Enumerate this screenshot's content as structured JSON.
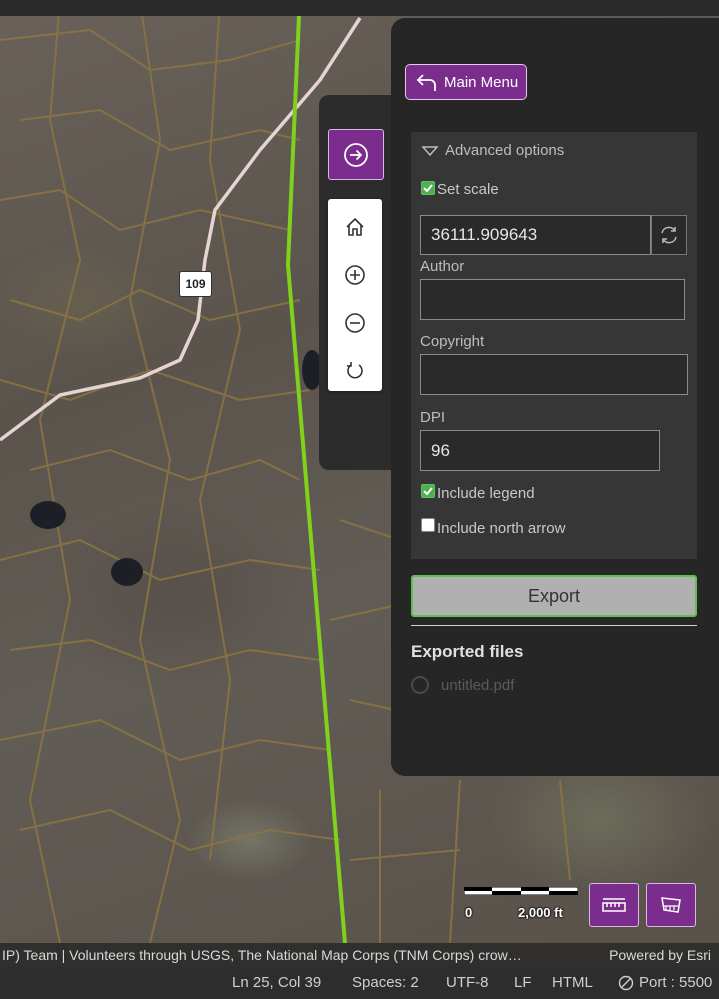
{
  "map": {
    "road_shield": "109",
    "scale_left": "0",
    "scale_right": "2,000 ft",
    "attribution": "IP) Team | Volunteers through USGS, The National Map Corps (TNM Corps) crow…",
    "powered_by": "Powered by Esri"
  },
  "widget": {
    "toggle_icon": "arrow-right-circle-icon",
    "zoom_buttons": [
      "home-icon",
      "zoom-in-icon",
      "zoom-out-icon",
      "rotate-icon"
    ]
  },
  "print_panel": {
    "main_menu_label": "Main Menu",
    "advanced_label": "Advanced options",
    "set_scale_label": "Set scale",
    "set_scale_checked": true,
    "scale_value": "36111.909643",
    "author_label": "Author",
    "author_value": "",
    "copyright_label": "Copyright",
    "copyright_value": "",
    "dpi_label": "DPI",
    "dpi_value": "96",
    "include_legend_label": "Include legend",
    "include_legend_checked": true,
    "north_arrow_label": "Include north arrow",
    "north_arrow_checked": false,
    "export_label": "Export",
    "exported_title": "Exported files",
    "exported_file": "untitled.pdf"
  },
  "statusbar": {
    "cursor": "Ln 25, Col 39",
    "spaces": "Spaces: 2",
    "encoding": "UTF-8",
    "eol": "LF",
    "language": "HTML",
    "port": "Port : 5500"
  },
  "colors": {
    "accent_purple": "#7b2d8e",
    "boundary_line": "#7fd11b",
    "parcel_lines": "#8a7440",
    "road": "#e6d4d4"
  }
}
